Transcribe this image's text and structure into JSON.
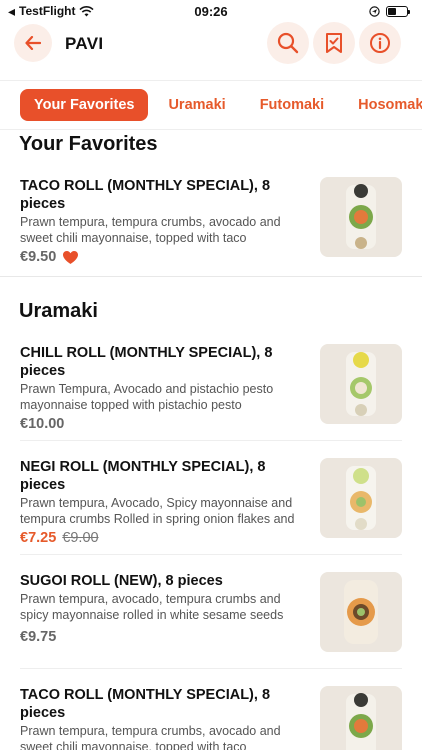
{
  "status_bar": {
    "carrier": "TestFlight",
    "time": "09:26"
  },
  "header": {
    "title": "PAVI"
  },
  "tabs": [
    {
      "label": "Your Favorites",
      "active": true
    },
    {
      "label": "Uramaki",
      "active": false
    },
    {
      "label": "Futomaki",
      "active": false
    },
    {
      "label": "Hosomaki",
      "active": false
    }
  ],
  "sections": [
    {
      "title": "Your Favorites",
      "items": [
        {
          "name": "TACO ROLL (MONTHLY SPECIAL), 8 pieces",
          "description": "Prawn tempura, tempura crumbs, avocado and sweet chili mayonnaise, topped with taco",
          "price": "€9.50",
          "favorite": true
        }
      ]
    },
    {
      "title": "Uramaki",
      "items": [
        {
          "name": "CHILL ROLL (MONTHLY SPECIAL), 8 pieces",
          "description": "Prawn Tempura, Avocado and pistachio pesto mayonnaise topped with pistachio pesto",
          "price": "€10.00"
        },
        {
          "name": "NEGI ROLL (MONTHLY SPECIAL), 8 pieces",
          "description": "Prawn tempura, Avocado, Spicy mayonnaise and tempura crumbs Rolled in spring onion flakes and",
          "price": "€7.25",
          "old_price": "€9.00"
        },
        {
          "name": "SUGOI ROLL (NEW), 8 pieces",
          "description": "Prawn tempura, avocado, tempura crumbs and spicy mayonnaise rolled in white sesame seeds",
          "price": "€9.75"
        },
        {
          "name": "TACO ROLL (MONTHLY SPECIAL), 8 pieces",
          "description": "Prawn tempura, tempura crumbs, avocado and sweet chili mayonnaise, topped with taco"
        }
      ]
    }
  ],
  "colors": {
    "accent": "#e8502a",
    "accent_bg": "#fbeee8",
    "thumb_bg": "#ece6de"
  },
  "icons": [
    "wifi-icon",
    "location-icon",
    "battery-icon",
    "back-arrow-icon",
    "search-icon",
    "bookmark-icon",
    "info-icon",
    "heart-icon"
  ]
}
